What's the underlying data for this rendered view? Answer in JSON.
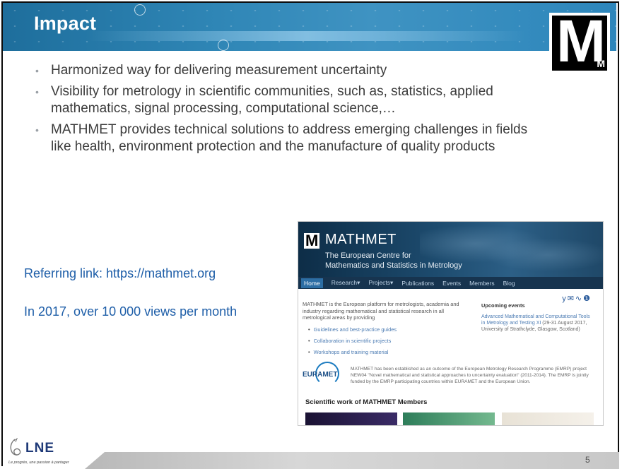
{
  "slide": {
    "title": "Impact",
    "page_number": "5",
    "bullets": [
      "Harmonized way for delivering measurement uncertainty",
      "Visibility for metrology in scientific communities, such as, statistics, applied mathematics, signal processing, computational science,…",
      "MATHMET provides technical solutions to address emerging challenges in fields like health, environment protection and the manufacture of quality products"
    ],
    "link_text": "Referring link: https://mathmet.org",
    "stat_text": "In 2017, over 10 000 views per month",
    "corner_logo": {
      "letter": "M",
      "small": "M"
    },
    "footer_logo": {
      "word": "LNE",
      "tagline": "Le progrès, une passion à partager"
    }
  },
  "website": {
    "logo_letter": "M",
    "brand": "MATHMET",
    "subtitle_line1": "The European Centre for",
    "subtitle_line2": "Mathematics and Statistics in Metrology",
    "nav": [
      "Home",
      "Research▾",
      "Projects▾",
      "Publications",
      "Events",
      "Members",
      "Blog"
    ],
    "social_icons": "y✉∿❶",
    "intro": "MATHMET is the European platform for metrologists, academia and industry regarding mathematical and statistical research in all metrological areas by providing",
    "links": [
      "Guidelines and best-practice guides",
      "Collaboration in scientific projects",
      "Workshops and training material"
    ],
    "events_heading": "Upcoming events",
    "event_title": "Advanced Mathematical and Computational Tools in Metrology and Testing XI",
    "event_detail": "(29-31 August 2017, University of Strathclyde, Glasgow, Scotland)",
    "euramet_label": "EURAMET",
    "euramet_text": "MATHMET has been established as an outcome of the European Metrology Research Programme (EMRP) project NEW04 \"Novel mathematical and statistical approaches to uncertainty evaluation\" (2011-2014). The EMRP is jointly funded by the EMRP participating countries within EURAMET and the European Union.",
    "section_heading": "Scientific work of MATHMET Members"
  }
}
